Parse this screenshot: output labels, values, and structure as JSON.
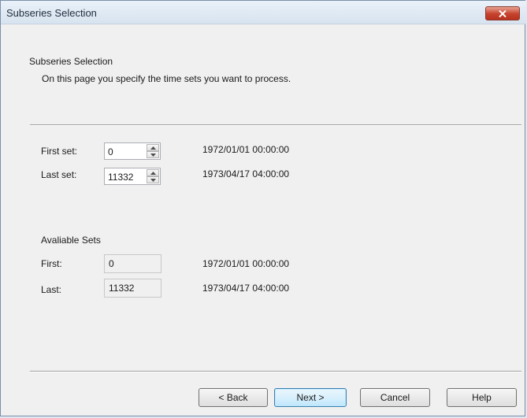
{
  "window": {
    "title": "Subseries Selection",
    "close_icon": "close-icon"
  },
  "header": {
    "title": "Subseries Selection",
    "subtitle": "On this page you specify the time sets you want to process."
  },
  "selection": {
    "first_label": "First set:",
    "first_value": "0",
    "first_time": "1972/01/01 00:00:00",
    "last_label": "Last set:",
    "last_value": "11332",
    "last_time": "1973/04/17 04:00:00"
  },
  "available": {
    "heading": "Avaliable Sets",
    "first_label": "First:",
    "first_value": "0",
    "first_time": "1972/01/01 00:00:00",
    "last_label": "Last:",
    "last_value": "11332",
    "last_time": "1973/04/17 04:00:00"
  },
  "buttons": {
    "back": "< Back",
    "next": "Next >",
    "cancel": "Cancel",
    "help": "Help"
  },
  "colors": {
    "titlebar": "#dfe8f2",
    "close_button": "#c5412b",
    "dialog_bg": "#f0f0f0",
    "default_button_border": "#3c7fb1"
  }
}
